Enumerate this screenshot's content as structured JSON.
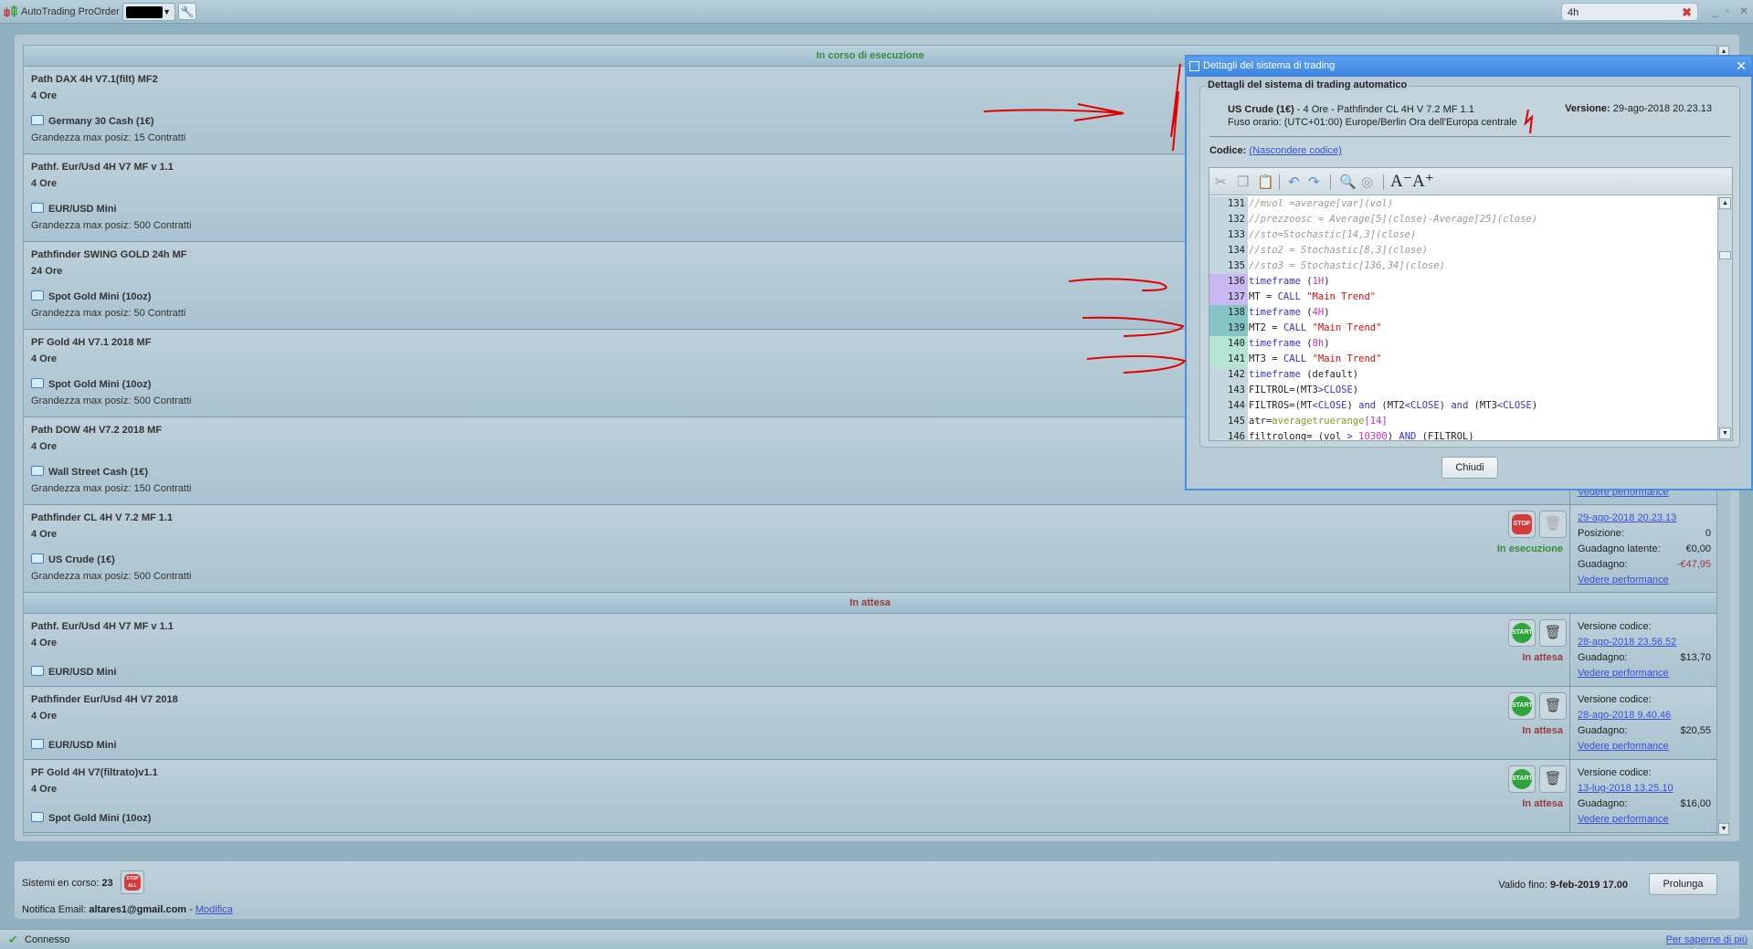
{
  "app": {
    "title": "AutoTrading ProOrder",
    "search_value": "4h"
  },
  "sections": {
    "running": "In corso di esecuzione",
    "waiting": "In attesa"
  },
  "running": [
    {
      "name": "Path DAX 4H V7.1(filt) MF2",
      "timeframe": "4 Ore",
      "instrument": "Germany 30 Cash (1€)",
      "max_pos": "Grandezza max posiz: 15 Contratti"
    },
    {
      "name": "Pathf. Eur/Usd 4H V7 MF v 1.1",
      "timeframe": "4 Ore",
      "instrument": "EUR/USD Mini",
      "max_pos": "Grandezza max posiz: 500 Contratti"
    },
    {
      "name": "Pathfinder SWING GOLD 24h MF",
      "timeframe": "24 Ore",
      "instrument": "Spot Gold Mini (10oz)",
      "max_pos": "Grandezza max posiz: 50 Contratti"
    },
    {
      "name": "PF Gold 4H V7.1 2018 MF",
      "timeframe": "4 Ore",
      "instrument": "Spot Gold Mini (10oz)",
      "max_pos": "Grandezza max posiz: 500 Contratti"
    },
    {
      "name": "Path DOW 4H V7.2 2018 MF",
      "timeframe": "4 Ore",
      "instrument": "Wall Street Cash (1€)",
      "max_pos": "Grandezza max posiz: 150 Contratti",
      "perf": "Vedere performance"
    },
    {
      "name": "Pathfinder CL 4H V 7.2 MF 1.1",
      "timeframe": "4 Ore",
      "instrument": "US Crude (1€)",
      "max_pos": "Grandezza max posiz: 500 Contratti",
      "status": "In esecuzione",
      "stop": "STOP",
      "version": "29-ago-2018 20.23.13",
      "pos_label": "Posizione:",
      "pos": "0",
      "latent_label": "Guadagno latente:",
      "latent": "€0,00",
      "gain_label": "Guadagno:",
      "gain": "-€47,95",
      "perf": "Vedere performance"
    }
  ],
  "waiting": [
    {
      "name": "Pathf. Eur/Usd 4H V7 MF v 1.1",
      "timeframe": "4 Ore",
      "instrument": "EUR/USD Mini",
      "status": "In attesa",
      "start": "START",
      "ver_label": "Versione codice:",
      "version": "28-ago-2018 23.56.52",
      "gain_label": "Guadagno:",
      "gain": "$13,70",
      "perf": "Vedere performance"
    },
    {
      "name": "Pathfinder Eur/Usd 4H V7 2018",
      "timeframe": "4 Ore",
      "instrument": "EUR/USD Mini",
      "status": "In attesa",
      "start": "START",
      "ver_label": "Versione codice:",
      "version": "28-ago-2018 9.40.46",
      "gain_label": "Guadagno:",
      "gain": "$20,55",
      "perf": "Vedere performance"
    },
    {
      "name": "PF Gold 4H V7(filtrato)v1.1",
      "timeframe": "4 Ore",
      "instrument": "Spot Gold Mini (10oz)",
      "status": "In attesa",
      "start": "START",
      "ver_label": "Versione codice:",
      "version": "13-lug-2018 13.25.10",
      "gain_label": "Guadagno:",
      "gain": "$16,00",
      "perf": "Vedere performance"
    }
  ],
  "bottom": {
    "systems_label": "Sistemi en corso:",
    "systems_count": "23",
    "stop_all": "STOP ALL",
    "email_label": "Notifica Email:",
    "email": "altares1@gmail.com",
    "email_sep": "-",
    "modify": "Modifica",
    "valid_label": "Valido fino:",
    "valid_date": "9-feb-2019 17.00",
    "extend": "Prolunga"
  },
  "statusbar": {
    "connected": "Connesso",
    "more": "Per saperne di più"
  },
  "dialog": {
    "title": "Dettagli del sistema di trading",
    "group": "Dettagli del sistema di trading automatico",
    "instrument": "US Crude (1€)",
    "info_rest": " - 4 Ore - Pathfinder CL 4H V 7.2 MF 1.1",
    "timezone": "Fuso orario: (UTC+01:00) Europe/Berlin Ora dell'Europa centrale",
    "version_label": "Versione:",
    "version": "29-ago-2018 20.23.13",
    "code_label": "Codice:",
    "hide_code": "(Nascondere codice)",
    "close": "Chiudi",
    "code_lines": [
      {
        "n": "131",
        "t": [
          [
            "//mvol =average[var](vol)",
            "c"
          ]
        ]
      },
      {
        "n": "132",
        "t": [
          [
            "//prezzoosc = Average[5](close)-Average[25](close)",
            "c"
          ]
        ]
      },
      {
        "n": "133",
        "t": [
          [
            "//sto=Stochastic[14,3](close)",
            "c"
          ]
        ]
      },
      {
        "n": "134",
        "t": [
          [
            "//sto2 = Stochastic[8,3](close)",
            "c"
          ]
        ]
      },
      {
        "n": "135",
        "t": [
          [
            "//sto3 = Stochastic[136,34](close)",
            "c"
          ]
        ]
      },
      {
        "n": "136",
        "hl": "#c9b8f2",
        "t": [
          [
            "timeframe",
            "k"
          ],
          [
            " (",
            "p"
          ],
          [
            "1H",
            "n"
          ],
          [
            ")",
            "p"
          ]
        ]
      },
      {
        "n": "137",
        "hl": "#c9b8f2",
        "t": [
          [
            "MT = ",
            "p"
          ],
          [
            "CALL",
            "k"
          ],
          [
            " ",
            "p"
          ],
          [
            "\"Main Trend\"",
            "s"
          ]
        ]
      },
      {
        "n": "138",
        "hl": "#84c4c4",
        "t": [
          [
            "timeframe",
            "k"
          ],
          [
            " (",
            "p"
          ],
          [
            "4H",
            "n"
          ],
          [
            ")",
            "p"
          ]
        ]
      },
      {
        "n": "139",
        "hl": "#84c4c4",
        "t": [
          [
            "MT2 = ",
            "p"
          ],
          [
            "CALL",
            "k"
          ],
          [
            " ",
            "p"
          ],
          [
            "\"Main Trend\"",
            "s"
          ]
        ]
      },
      {
        "n": "140",
        "hl": "#b4e4d2",
        "t": [
          [
            "timeframe",
            "k"
          ],
          [
            " (",
            "p"
          ],
          [
            "8h",
            "n"
          ],
          [
            ")",
            "p"
          ]
        ]
      },
      {
        "n": "141",
        "hl": "#b4e4d2",
        "t": [
          [
            "MT3 = ",
            "p"
          ],
          [
            "CALL",
            "k"
          ],
          [
            " ",
            "p"
          ],
          [
            "\"Main Trend\"",
            "s"
          ]
        ]
      },
      {
        "n": "142",
        "t": [
          [
            "timeframe",
            "k"
          ],
          [
            " (default)",
            "p"
          ]
        ]
      },
      {
        "n": "143",
        "t": [
          [
            "FILTROL=(MT3",
            "p"
          ],
          [
            ">CLOSE",
            "k"
          ],
          [
            ")",
            "p"
          ]
        ]
      },
      {
        "n": "144",
        "t": [
          [
            "FILTROS=(MT",
            "p"
          ],
          [
            "<CLOSE",
            "k"
          ],
          [
            ") ",
            "p"
          ],
          [
            "and",
            "k"
          ],
          [
            " (MT2",
            "p"
          ],
          [
            "<CLOSE",
            "k"
          ],
          [
            ") ",
            "p"
          ],
          [
            "and",
            "k"
          ],
          [
            " (MT3",
            "p"
          ],
          [
            "<CLOSE",
            "k"
          ],
          [
            ")",
            "p"
          ]
        ]
      },
      {
        "n": "145",
        "t": [
          [
            "atr=",
            "p"
          ],
          [
            "averagetruerange",
            "f"
          ],
          [
            "[14]",
            "n"
          ]
        ]
      },
      {
        "n": "146",
        "t": [
          [
            "filtrolong= (vol ",
            "p"
          ],
          [
            "> ",
            "k"
          ],
          [
            "10300",
            "n"
          ],
          [
            ") ",
            "p"
          ],
          [
            "AND",
            "k"
          ],
          [
            " (FILTROL)",
            "p"
          ]
        ]
      }
    ]
  },
  "colors": {
    "running": "#3a8a3a",
    "waiting": "#9a3b3b",
    "link": "#3a4fd0",
    "dialog_border": "#4a8ee0",
    "annotation": "#e00000"
  }
}
